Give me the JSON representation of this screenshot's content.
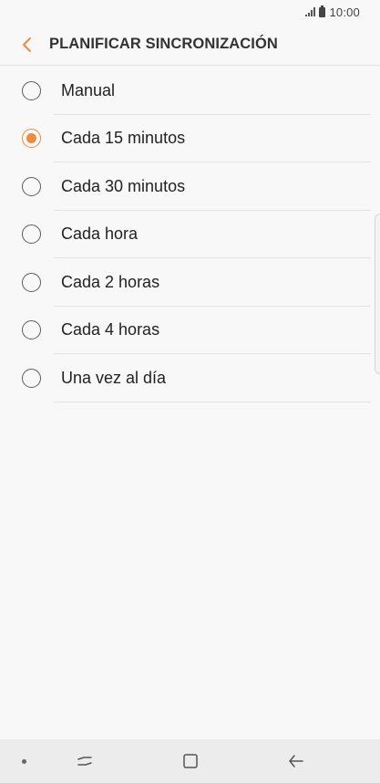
{
  "status_bar": {
    "time": "10:00",
    "icons": [
      "signal-icon",
      "battery-icon"
    ]
  },
  "header": {
    "title": "PLANIFICAR SINCRONIZACIÓN",
    "back_icon": "chevron-left-icon"
  },
  "options": [
    {
      "label": "Manual",
      "selected": false
    },
    {
      "label": "Cada 15 minutos",
      "selected": true
    },
    {
      "label": "Cada 30 minutos",
      "selected": false
    },
    {
      "label": "Cada hora",
      "selected": false
    },
    {
      "label": "Cada 2 horas",
      "selected": false
    },
    {
      "label": "Cada 4 horas",
      "selected": false
    },
    {
      "label": "Una vez al día",
      "selected": false
    }
  ],
  "nav_bar": {
    "icons": [
      "nav-dot-icon",
      "recent-apps-icon",
      "home-icon",
      "back-arrow-icon"
    ]
  },
  "colors": {
    "accent": "#f08a3c",
    "background": "#f8f8f8",
    "nav_background": "#ececec"
  }
}
